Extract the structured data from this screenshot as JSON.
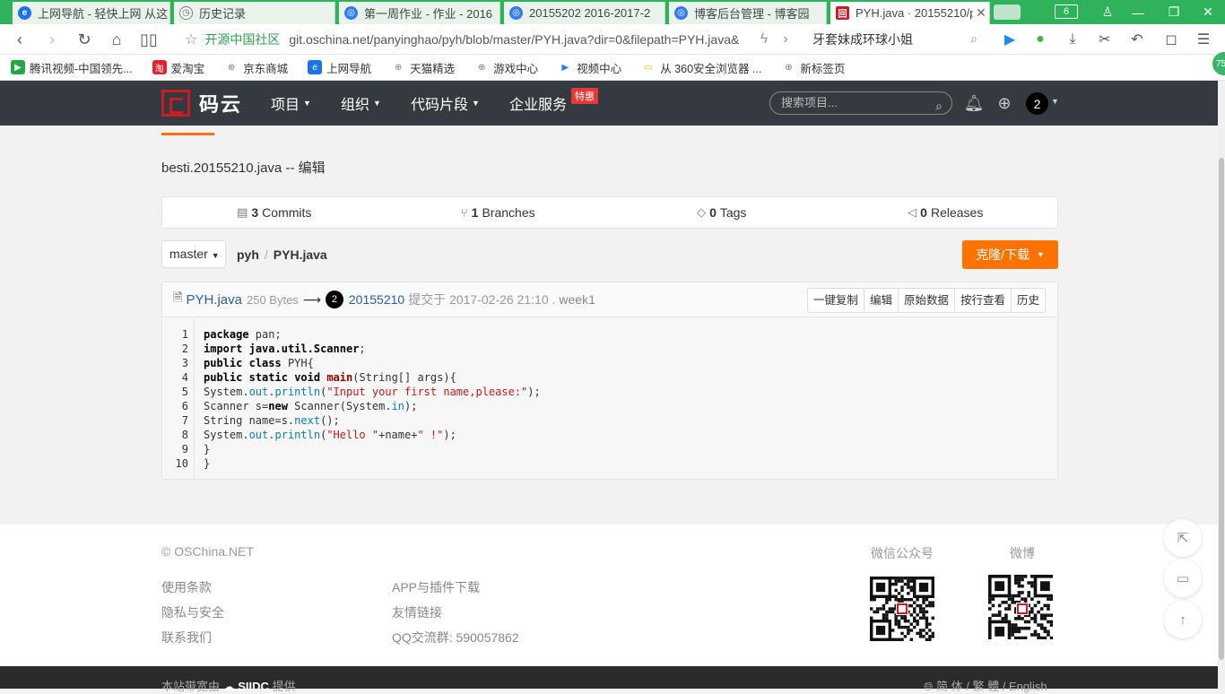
{
  "browser": {
    "tabs": [
      {
        "title": "上网导航 - 轻快上网 从这",
        "favicon_color": "#1a73e8",
        "favicon": "e"
      },
      {
        "title": "历史记录",
        "favicon_color": "#666666",
        "favicon": "◷"
      },
      {
        "title": "第一周作业 - 作业 - 2016",
        "favicon_color": "#2f7cf6",
        "favicon": "◎"
      },
      {
        "title": "20155202 2016-2017-2",
        "favicon_color": "#2f7cf6",
        "favicon": "◎"
      },
      {
        "title": "博客后台管理 - 博客园",
        "favicon_color": "#2f7cf6",
        "favicon": "◎"
      },
      {
        "title": "PYH.java · 20155210/p",
        "favicon_color": "#c71d23",
        "favicon": "回",
        "active": true
      }
    ],
    "tab_count": "6",
    "address": {
      "site_name": "开源中国社区",
      "url": "git.oschina.net/panyinghao/pyh/blob/master/PYH.java?dir=0&filepath=PYH.java&"
    },
    "search_text": "牙套妹成环球小姐",
    "bookmarks": [
      {
        "label": "腾讯视频-中国领先...",
        "color": "#22a845",
        "icon": "▶"
      },
      {
        "label": "爱淘宝",
        "color": "#e0242b",
        "icon": "淘"
      },
      {
        "label": "京东商城",
        "color": "#888888",
        "icon": "⊕"
      },
      {
        "label": "上网导航",
        "color": "#1a73e8",
        "icon": "e"
      },
      {
        "label": "天猫精选",
        "color": "#888888",
        "icon": "⊕"
      },
      {
        "label": "游戏中心",
        "color": "#888888",
        "icon": "⊕"
      },
      {
        "label": "视频中心",
        "color": "#2b7de9",
        "icon": "▶"
      },
      {
        "label": "从 360安全浏览器 ...",
        "color": "#e8b400",
        "icon": "▭"
      },
      {
        "label": "新标签页",
        "color": "#888888",
        "icon": "⊕"
      }
    ],
    "badge": "75"
  },
  "site": {
    "logo_text": "码云",
    "nav": [
      "项目",
      "组织",
      "代码片段",
      "企业服务"
    ],
    "promo_badge": "特惠",
    "search_placeholder": "搜索项目...",
    "user_badge": "2"
  },
  "repo": {
    "title": "besti.20155210.java",
    "title_suffix": "-- 编辑",
    "stats": [
      {
        "count": "3",
        "label": "Commits",
        "icon": "▤"
      },
      {
        "count": "1",
        "label": "Branches",
        "icon": "⑂"
      },
      {
        "count": "0",
        "label": "Tags",
        "icon": "◇"
      },
      {
        "count": "0",
        "label": "Releases",
        "icon": "◁"
      }
    ],
    "branch": "master",
    "breadcrumb": [
      "pyh",
      "PYH.java"
    ],
    "clone_button": "克隆/下载"
  },
  "file": {
    "name": "PYH.java",
    "size": "250 Bytes",
    "arrow": "⟶",
    "author_badge": "2",
    "author": "20155210",
    "commit_info": "提交于 2017-02-26 21:10 .",
    "message": "week1",
    "buttons": [
      "一键复制",
      "编辑",
      "原始数据",
      "按行查看",
      "历史"
    ],
    "lines": [
      "1",
      "2",
      "3",
      "4",
      "5",
      "6",
      "7",
      "8",
      "9",
      "10"
    ]
  },
  "footer": {
    "copyright": "© OSChina.NET",
    "col1": [
      "使用条款",
      "隐私与安全",
      "联系我们"
    ],
    "col2": [
      "APP与插件下载",
      "友情链接",
      "QQ交流群: 590057862"
    ],
    "wechat_label": "微信公众号",
    "weibo_label": "微博",
    "bottom_left": "本站带宽由",
    "bottom_left_suffix": "提供",
    "bottom_right": "简 体 / 繁 體 / English"
  }
}
